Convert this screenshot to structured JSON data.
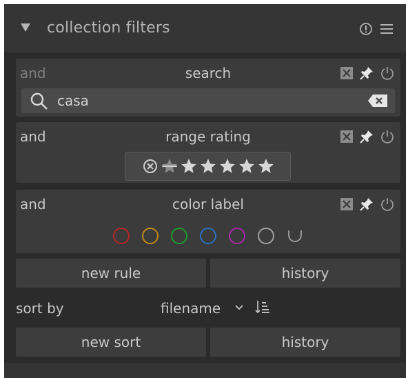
{
  "header": {
    "title": "collection filters",
    "collapse_icon": "triangle-down-icon",
    "icons": [
      "info-icon",
      "hamburger-menu-icon"
    ]
  },
  "rules": [
    {
      "operator": "and",
      "title": "search",
      "control": "search",
      "search_value": "casa",
      "actions": [
        "remove-rule-icon",
        "pin-icon",
        "power-icon"
      ]
    },
    {
      "operator": "and",
      "title": "range rating",
      "control": "rating",
      "rating_items": [
        "rejected-icon",
        "not-rated-icon",
        "star-icon",
        "star-icon",
        "star-icon",
        "star-icon",
        "star-icon"
      ],
      "actions": [
        "remove-rule-icon",
        "pin-icon",
        "power-icon"
      ]
    },
    {
      "operator": "and",
      "title": "color label",
      "control": "color",
      "color_labels": [
        {
          "name": "red",
          "color": "#b5262b"
        },
        {
          "name": "yellow",
          "color": "#c08a17"
        },
        {
          "name": "green",
          "color": "#1e9c2d"
        },
        {
          "name": "blue",
          "color": "#2f6dc0"
        },
        {
          "name": "purple",
          "color": "#a42ca6"
        },
        {
          "name": "gray",
          "color": "#a0a0a0"
        }
      ],
      "actions": [
        "remove-rule-icon",
        "pin-icon",
        "power-icon"
      ]
    }
  ],
  "buttons": {
    "new_rule": "new rule",
    "history_rules": "history",
    "new_sort": "new sort",
    "history_sort": "history"
  },
  "sort": {
    "label": "sort by",
    "value": "filename"
  },
  "colors": {
    "panel_bg": "#2b2b2b",
    "header_bg": "#353535",
    "rule_bg": "#3b3b3b",
    "text": "#c8c8c8"
  }
}
